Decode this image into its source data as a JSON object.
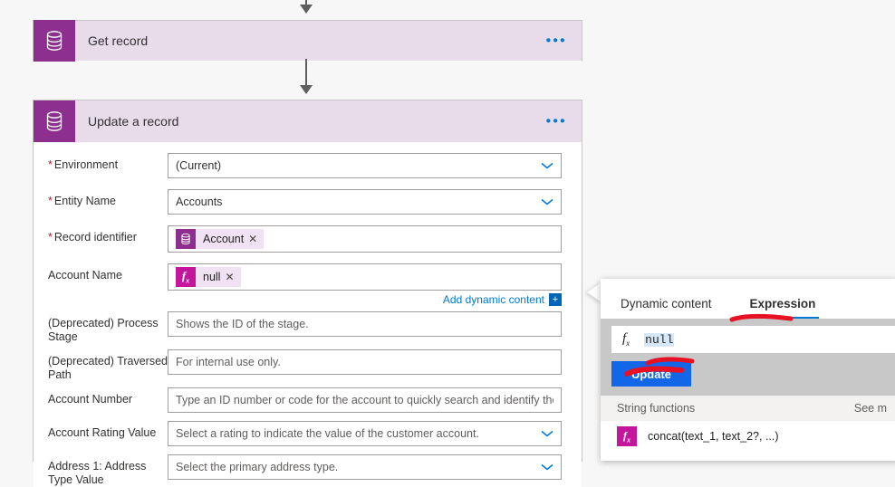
{
  "flow": {
    "cards": [
      {
        "title": "Get record",
        "icon": "database-icon",
        "ellipsis": "•••"
      },
      {
        "title": "Update a record",
        "icon": "database-icon",
        "ellipsis": "•••"
      }
    ]
  },
  "form": {
    "fields": [
      {
        "label": "Environment",
        "required": true,
        "type": "dropdown",
        "value": "(Current)"
      },
      {
        "label": "Entity Name",
        "required": true,
        "type": "dropdown",
        "value": "Accounts"
      },
      {
        "label": "Record identifier",
        "required": true,
        "type": "token",
        "token": {
          "text": "Account",
          "icon": "database-icon",
          "remove": "✕"
        }
      },
      {
        "label": "Account Name",
        "required": false,
        "type": "token",
        "token": {
          "text": "null",
          "icon": "fx-icon",
          "remove": "✕"
        }
      },
      {
        "label": "(Deprecated) Process Stage",
        "required": false,
        "type": "text",
        "placeholder": "Shows the ID of the stage."
      },
      {
        "label": "(Deprecated) Traversed Path",
        "required": false,
        "type": "text",
        "placeholder": "For internal use only."
      },
      {
        "label": "Account Number",
        "required": false,
        "type": "text",
        "placeholder": "Type an ID number or code for the account to quickly search and identify the ac"
      },
      {
        "label": "Account Rating Value",
        "required": false,
        "type": "dropdown",
        "placeholder": "Select a rating to indicate the value of the customer account."
      },
      {
        "label": "Address 1: Address Type Value",
        "required": false,
        "type": "dropdown",
        "placeholder": "Select the primary address type."
      }
    ],
    "add_dynamic_content": {
      "label": "Add dynamic content",
      "plus": "+"
    },
    "required_marker": "*"
  },
  "expression_panel": {
    "tabs": [
      {
        "label": "Dynamic content",
        "active": false
      },
      {
        "label": "Expression",
        "active": true
      }
    ],
    "editor": {
      "fx_label": "fx",
      "expression": "null"
    },
    "update_button": "Update",
    "section": {
      "title": "String functions",
      "see_more": "See m"
    },
    "functions": [
      {
        "icon": "fx-icon",
        "signature": "concat(text_1, text_2?, ...)"
      }
    ]
  },
  "colors": {
    "brand_purple": "#8c2f8f",
    "card_header": "#e8dcea",
    "accent_blue": "#0078d4",
    "button_blue": "#1267e8",
    "fx_magenta": "#c4169c",
    "required_red": "#a4262c",
    "annotation_red": "#e81123",
    "canvas": "#f7f7f7"
  }
}
